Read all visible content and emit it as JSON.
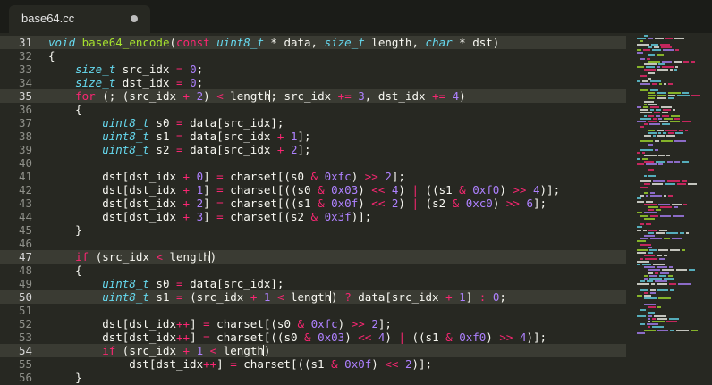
{
  "tab": {
    "title": "base64.cc",
    "modified_indicator": "dirty-dot-icon"
  },
  "gutter": {
    "line_numbers": [
      "31",
      "32",
      "33",
      "34",
      "35",
      "36",
      "37",
      "38",
      "39",
      "40",
      "41",
      "42",
      "43",
      "44",
      "45",
      "46",
      "47",
      "48",
      "49",
      "50",
      "51",
      "52",
      "53",
      "54",
      "55",
      "56"
    ],
    "active_lines": [
      0,
      4,
      16,
      19,
      23
    ]
  },
  "code_lines": [
    [
      {
        "c": "t",
        "s": "void"
      },
      {
        "s": " "
      },
      {
        "c": "f",
        "s": "base64_encode"
      },
      {
        "s": "("
      },
      {
        "c": "k",
        "s": "const"
      },
      {
        "s": " "
      },
      {
        "c": "t",
        "s": "uint8_t"
      },
      {
        "s": " * data, "
      },
      {
        "c": "t",
        "s": "size_t"
      },
      {
        "s": " length"
      },
      {
        "cursor": true
      },
      {
        "s": ", "
      },
      {
        "c": "t",
        "s": "char"
      },
      {
        "s": " * dst)"
      }
    ],
    [
      {
        "s": "{"
      }
    ],
    [
      {
        "s": "    "
      },
      {
        "c": "t",
        "s": "size_t"
      },
      {
        "s": " src_idx "
      },
      {
        "c": "k",
        "s": "="
      },
      {
        "s": " "
      },
      {
        "c": "n",
        "s": "0"
      },
      {
        "s": ";"
      }
    ],
    [
      {
        "s": "    "
      },
      {
        "c": "t",
        "s": "size_t"
      },
      {
        "s": " dst_idx "
      },
      {
        "c": "k",
        "s": "="
      },
      {
        "s": " "
      },
      {
        "c": "n",
        "s": "0"
      },
      {
        "s": ";"
      }
    ],
    [
      {
        "s": "    "
      },
      {
        "c": "k",
        "s": "for"
      },
      {
        "s": " (; (src_idx "
      },
      {
        "c": "k",
        "s": "+"
      },
      {
        "s": " "
      },
      {
        "c": "n",
        "s": "2"
      },
      {
        "s": ") "
      },
      {
        "c": "k",
        "s": "<"
      },
      {
        "s": " length"
      },
      {
        "cursor": true
      },
      {
        "s": "; src_idx "
      },
      {
        "c": "k",
        "s": "+="
      },
      {
        "s": " "
      },
      {
        "c": "n",
        "s": "3"
      },
      {
        "s": ", dst_idx "
      },
      {
        "c": "k",
        "s": "+="
      },
      {
        "s": " "
      },
      {
        "c": "n",
        "s": "4"
      },
      {
        "s": ")"
      }
    ],
    [
      {
        "s": "    {"
      }
    ],
    [
      {
        "s": "        "
      },
      {
        "c": "t",
        "s": "uint8_t"
      },
      {
        "s": " s0 "
      },
      {
        "c": "k",
        "s": "="
      },
      {
        "s": " data[src_idx];"
      }
    ],
    [
      {
        "s": "        "
      },
      {
        "c": "t",
        "s": "uint8_t"
      },
      {
        "s": " s1 "
      },
      {
        "c": "k",
        "s": "="
      },
      {
        "s": " data[src_idx "
      },
      {
        "c": "k",
        "s": "+"
      },
      {
        "s": " "
      },
      {
        "c": "n",
        "s": "1"
      },
      {
        "s": "];"
      }
    ],
    [
      {
        "s": "        "
      },
      {
        "c": "t",
        "s": "uint8_t"
      },
      {
        "s": " s2 "
      },
      {
        "c": "k",
        "s": "="
      },
      {
        "s": " data[src_idx "
      },
      {
        "c": "k",
        "s": "+"
      },
      {
        "s": " "
      },
      {
        "c": "n",
        "s": "2"
      },
      {
        "s": "];"
      }
    ],
    [
      {
        "s": ""
      }
    ],
    [
      {
        "s": "        dst[dst_idx "
      },
      {
        "c": "k",
        "s": "+"
      },
      {
        "s": " "
      },
      {
        "c": "n",
        "s": "0"
      },
      {
        "s": "] "
      },
      {
        "c": "k",
        "s": "="
      },
      {
        "s": " charset[(s0 "
      },
      {
        "c": "k",
        "s": "&"
      },
      {
        "s": " "
      },
      {
        "c": "n",
        "s": "0xfc"
      },
      {
        "s": ") "
      },
      {
        "c": "k",
        "s": ">>"
      },
      {
        "s": " "
      },
      {
        "c": "n",
        "s": "2"
      },
      {
        "s": "];"
      }
    ],
    [
      {
        "s": "        dst[dst_idx "
      },
      {
        "c": "k",
        "s": "+"
      },
      {
        "s": " "
      },
      {
        "c": "n",
        "s": "1"
      },
      {
        "s": "] "
      },
      {
        "c": "k",
        "s": "="
      },
      {
        "s": " charset[((s0 "
      },
      {
        "c": "k",
        "s": "&"
      },
      {
        "s": " "
      },
      {
        "c": "n",
        "s": "0x03"
      },
      {
        "s": ") "
      },
      {
        "c": "k",
        "s": "<<"
      },
      {
        "s": " "
      },
      {
        "c": "n",
        "s": "4"
      },
      {
        "s": ") "
      },
      {
        "c": "k",
        "s": "|"
      },
      {
        "s": " ((s1 "
      },
      {
        "c": "k",
        "s": "&"
      },
      {
        "s": " "
      },
      {
        "c": "n",
        "s": "0xf0"
      },
      {
        "s": ") "
      },
      {
        "c": "k",
        "s": ">>"
      },
      {
        "s": " "
      },
      {
        "c": "n",
        "s": "4"
      },
      {
        "s": ")];"
      }
    ],
    [
      {
        "s": "        dst[dst_idx "
      },
      {
        "c": "k",
        "s": "+"
      },
      {
        "s": " "
      },
      {
        "c": "n",
        "s": "2"
      },
      {
        "s": "] "
      },
      {
        "c": "k",
        "s": "="
      },
      {
        "s": " charset[((s1 "
      },
      {
        "c": "k",
        "s": "&"
      },
      {
        "s": " "
      },
      {
        "c": "n",
        "s": "0x0f"
      },
      {
        "s": ") "
      },
      {
        "c": "k",
        "s": "<<"
      },
      {
        "s": " "
      },
      {
        "c": "n",
        "s": "2"
      },
      {
        "s": ") "
      },
      {
        "c": "k",
        "s": "|"
      },
      {
        "s": " (s2 "
      },
      {
        "c": "k",
        "s": "&"
      },
      {
        "s": " "
      },
      {
        "c": "n",
        "s": "0xc0"
      },
      {
        "s": ") "
      },
      {
        "c": "k",
        "s": ">>"
      },
      {
        "s": " "
      },
      {
        "c": "n",
        "s": "6"
      },
      {
        "s": "];"
      }
    ],
    [
      {
        "s": "        dst[dst_idx "
      },
      {
        "c": "k",
        "s": "+"
      },
      {
        "s": " "
      },
      {
        "c": "n",
        "s": "3"
      },
      {
        "s": "] "
      },
      {
        "c": "k",
        "s": "="
      },
      {
        "s": " charset[(s2 "
      },
      {
        "c": "k",
        "s": "&"
      },
      {
        "s": " "
      },
      {
        "c": "n",
        "s": "0x3f"
      },
      {
        "s": ")];"
      }
    ],
    [
      {
        "s": "    }"
      }
    ],
    [
      {
        "s": ""
      }
    ],
    [
      {
        "s": "    "
      },
      {
        "c": "k",
        "s": "if"
      },
      {
        "s": " (src_idx "
      },
      {
        "c": "k",
        "s": "<"
      },
      {
        "s": " length"
      },
      {
        "cursor": true
      },
      {
        "s": ")"
      }
    ],
    [
      {
        "s": "    {"
      }
    ],
    [
      {
        "s": "        "
      },
      {
        "c": "t",
        "s": "uint8_t"
      },
      {
        "s": " s0 "
      },
      {
        "c": "k",
        "s": "="
      },
      {
        "s": " data[src_idx];"
      }
    ],
    [
      {
        "s": "        "
      },
      {
        "c": "t",
        "s": "uint8_t"
      },
      {
        "s": " s1 "
      },
      {
        "c": "k",
        "s": "="
      },
      {
        "s": " (src_idx "
      },
      {
        "c": "k",
        "s": "+"
      },
      {
        "s": " "
      },
      {
        "c": "n",
        "s": "1"
      },
      {
        "s": " "
      },
      {
        "c": "k",
        "s": "<"
      },
      {
        "s": " length"
      },
      {
        "cursor": true
      },
      {
        "s": ") "
      },
      {
        "c": "k",
        "s": "?"
      },
      {
        "s": " data[src_idx "
      },
      {
        "c": "k",
        "s": "+"
      },
      {
        "s": " "
      },
      {
        "c": "n",
        "s": "1"
      },
      {
        "s": "] "
      },
      {
        "c": "k",
        "s": ":"
      },
      {
        "s": " "
      },
      {
        "c": "n",
        "s": "0"
      },
      {
        "s": ";"
      }
    ],
    [
      {
        "s": ""
      }
    ],
    [
      {
        "s": "        dst[dst_idx"
      },
      {
        "c": "k",
        "s": "++"
      },
      {
        "s": "] "
      },
      {
        "c": "k",
        "s": "="
      },
      {
        "s": " charset[(s0 "
      },
      {
        "c": "k",
        "s": "&"
      },
      {
        "s": " "
      },
      {
        "c": "n",
        "s": "0xfc"
      },
      {
        "s": ") "
      },
      {
        "c": "k",
        "s": ">>"
      },
      {
        "s": " "
      },
      {
        "c": "n",
        "s": "2"
      },
      {
        "s": "];"
      }
    ],
    [
      {
        "s": "        dst[dst_idx"
      },
      {
        "c": "k",
        "s": "++"
      },
      {
        "s": "] "
      },
      {
        "c": "k",
        "s": "="
      },
      {
        "s": " charset[((s0 "
      },
      {
        "c": "k",
        "s": "&"
      },
      {
        "s": " "
      },
      {
        "c": "n",
        "s": "0x03"
      },
      {
        "s": ") "
      },
      {
        "c": "k",
        "s": "<<"
      },
      {
        "s": " "
      },
      {
        "c": "n",
        "s": "4"
      },
      {
        "s": ") "
      },
      {
        "c": "k",
        "s": "|"
      },
      {
        "s": " ((s1 "
      },
      {
        "c": "k",
        "s": "&"
      },
      {
        "s": " "
      },
      {
        "c": "n",
        "s": "0xf0"
      },
      {
        "s": ") "
      },
      {
        "c": "k",
        "s": ">>"
      },
      {
        "s": " "
      },
      {
        "c": "n",
        "s": "4"
      },
      {
        "s": ")];"
      }
    ],
    [
      {
        "s": "        "
      },
      {
        "c": "k",
        "s": "if"
      },
      {
        "s": " (src_idx "
      },
      {
        "c": "k",
        "s": "+"
      },
      {
        "s": " "
      },
      {
        "c": "n",
        "s": "1"
      },
      {
        "s": " "
      },
      {
        "c": "k",
        "s": "<"
      },
      {
        "s": " length"
      },
      {
        "cursor": true
      },
      {
        "s": ")"
      }
    ],
    [
      {
        "s": "            dst[dst_idx"
      },
      {
        "c": "k",
        "s": "++"
      },
      {
        "s": "] "
      },
      {
        "c": "k",
        "s": "="
      },
      {
        "s": " charset[((s1 "
      },
      {
        "c": "k",
        "s": "&"
      },
      {
        "s": " "
      },
      {
        "c": "n",
        "s": "0x0f"
      },
      {
        "s": ") "
      },
      {
        "c": "k",
        "s": "<<"
      },
      {
        "s": " "
      },
      {
        "c": "n",
        "s": "2"
      },
      {
        "s": ")];"
      }
    ],
    [
      {
        "s": "    }"
      }
    ]
  ],
  "theme": {
    "background": "#272822",
    "keyword": "#f92672",
    "type": "#66d9ef",
    "function": "#a6e22e",
    "number": "#ae81ff",
    "text": "#f8f8f2"
  },
  "minimap": {
    "visible": true
  }
}
